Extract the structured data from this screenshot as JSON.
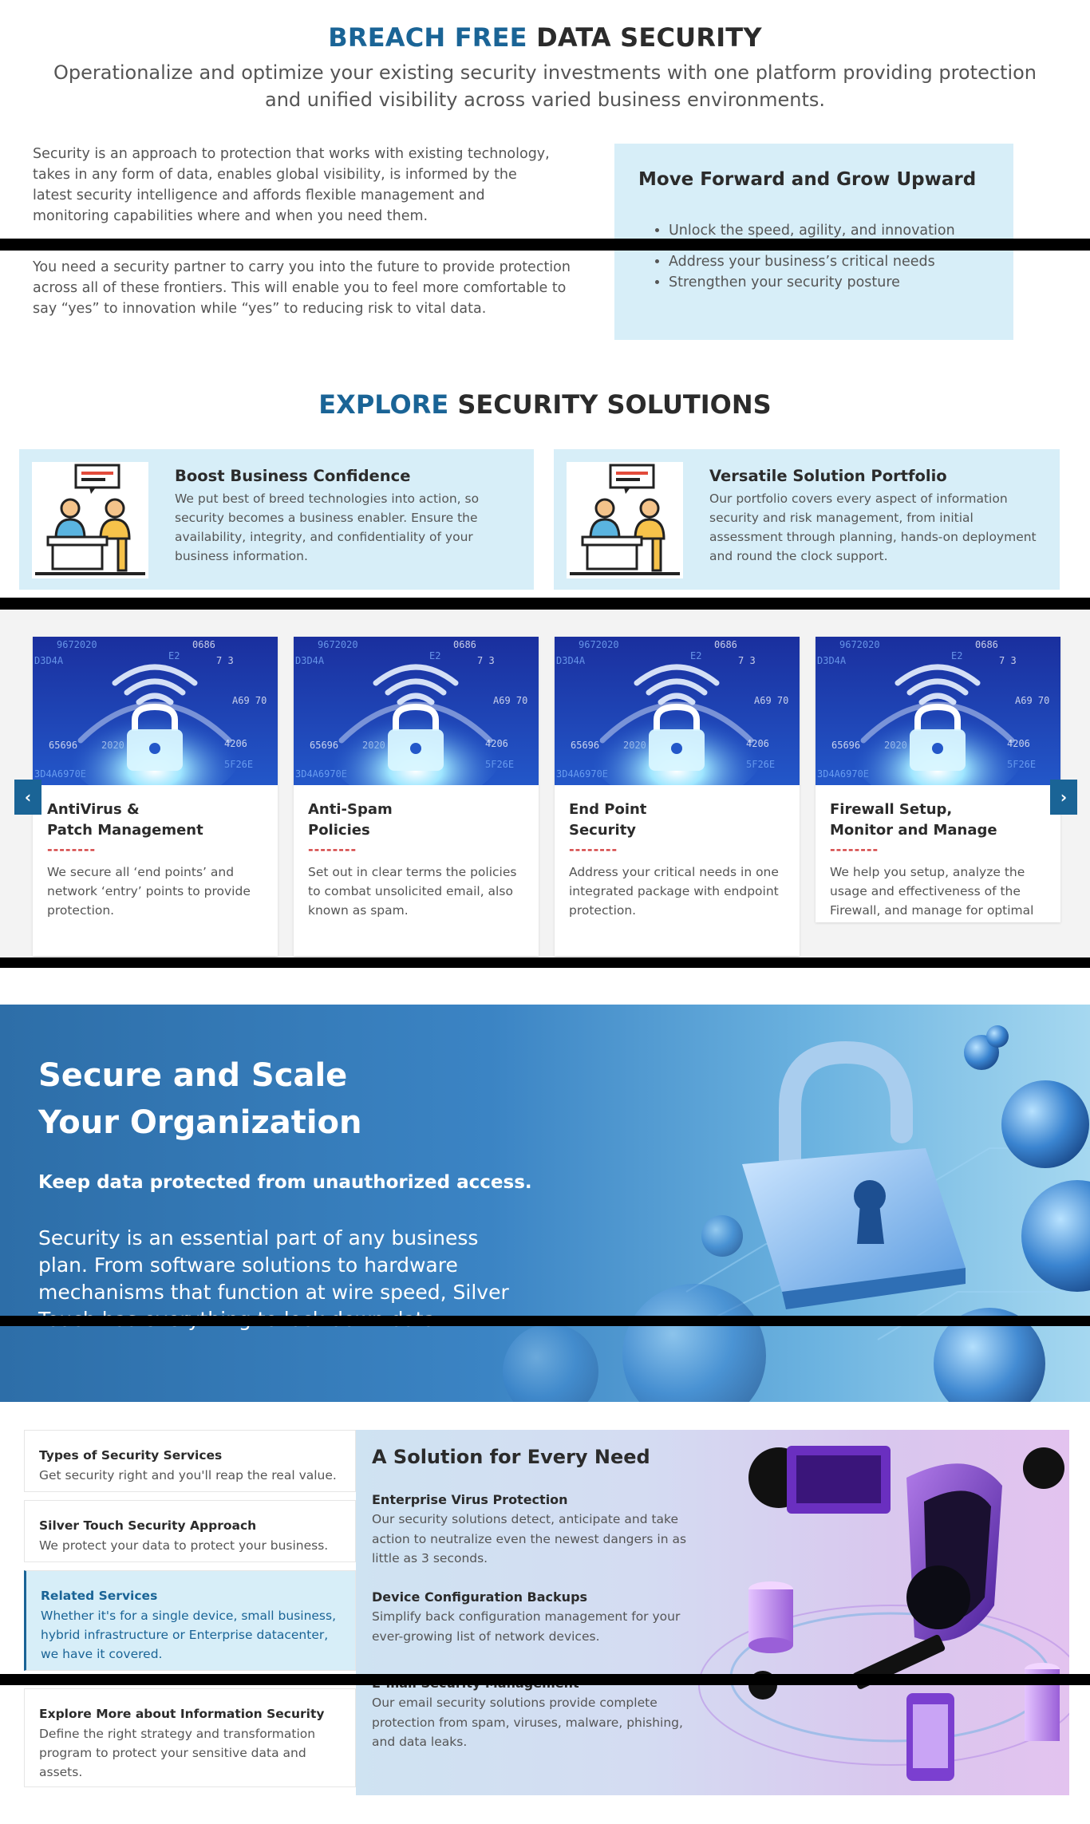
{
  "breach": {
    "title_accent": "BREACH FREE",
    "title_rest": "DATA SECURITY",
    "subtitle": "Operationalize and optimize your existing security investments with one platform providing protection and unified visibility across varied business environments.",
    "paragraph1": "Security is an approach to protection that works with existing technology, takes in any form of data, enables global visibility, is informed by the latest security intelligence and affords flexible management and monitoring capabilities where and when you need them.",
    "paragraph2": "You need a security partner to carry you into the future to provide protection across all of these frontiers. This will enable you to feel more comfortable to say “yes” to innovation while “yes” to reducing risk to vital data."
  },
  "move_forward": {
    "title": "Move Forward and Grow Upward",
    "items": [
      "Unlock the speed, agility, and innovation",
      "Address your business’s critical needs",
      "Strengthen your security posture"
    ]
  },
  "explore": {
    "title_accent": "EXPLORE",
    "title_rest": "SECURITY SOLUTIONS",
    "cards": [
      {
        "title": "Boost Business Confidence",
        "text": "We put best of breed technologies into action, so security becomes a business enabler. Ensure the availability, integrity, and confidentiality of your business information.",
        "icon": "meeting-icon"
      },
      {
        "title": "Versatile Solution Portfolio",
        "text": "Our portfolio covers every aspect of information security and risk management, from initial assessment through planning, hands-on deployment and round the clock support.",
        "icon": "meeting-icon"
      }
    ]
  },
  "carousel": {
    "prev": "‹",
    "next": "›",
    "image_texts": [
      "9672020",
      "0686",
      "D3D4A",
      "E2",
      "7 3",
      "A69 70",
      "65696",
      "2020",
      "4206",
      "3D4A6970E",
      "5F26E"
    ],
    "dash": "--------",
    "cards": [
      {
        "title": "AntiVirus &\nPatch Management",
        "text": "We secure all ‘end points’ and network ‘entry’ points to provide protection."
      },
      {
        "title": "Anti-Spam\nPolicies",
        "text": "Set out in clear terms the policies to combat unsolicited email, also known as spam."
      },
      {
        "title": "End Point\nSecurity",
        "text": "Address your critical needs in one integrated package with endpoint protection."
      },
      {
        "title": "Firewall Setup,\nMonitor and Manage",
        "text": "We help you setup, analyze the usage and effectiveness of the Firewall, and manage for optimal performance."
      }
    ]
  },
  "scale": {
    "title": "Secure and Scale\nYour Organization",
    "subtitle": "Keep data protected from unauthorized access.",
    "text": "Security is an essential part of any business plan. From software solutions to hardware mechanisms that function at wire speed, Silver Touch has everything to lock down data."
  },
  "tabs": [
    {
      "title": "Types of Security Services",
      "desc": "Get security right and you'll reap the real value.",
      "active": false
    },
    {
      "title": "Silver Touch Security Approach",
      "desc": "We protect your data to protect your business.",
      "active": false
    },
    {
      "title": "Related Services",
      "desc": "Whether it's for a single device, small business, hybrid infrastructure or Enterprise datacenter, we have it covered.",
      "active": true
    },
    {
      "title": "Explore More about Information Security",
      "desc": "Define the right strategy and transformation program to protect your sensitive data and assets.",
      "active": false
    }
  ],
  "need": {
    "title": "A Solution for Every Need",
    "items": [
      {
        "title": "Enterprise Virus Protection",
        "text": "Our security solutions detect, anticipate and take action to neutralize even the newest dangers in as little as 3 seconds."
      },
      {
        "title": "Device Configuration Backups",
        "text": "Simplify back configuration management for your ever-growing list of network devices."
      },
      {
        "title": "E-mail Security Management",
        "text": "Our email security solutions provide complete protection from spam, viruses, malware, phishing, and data leaks."
      }
    ]
  },
  "colors": {
    "accent": "#1a6496",
    "light_panel": "#d7eef8",
    "dash_red": "#d23a3a"
  }
}
